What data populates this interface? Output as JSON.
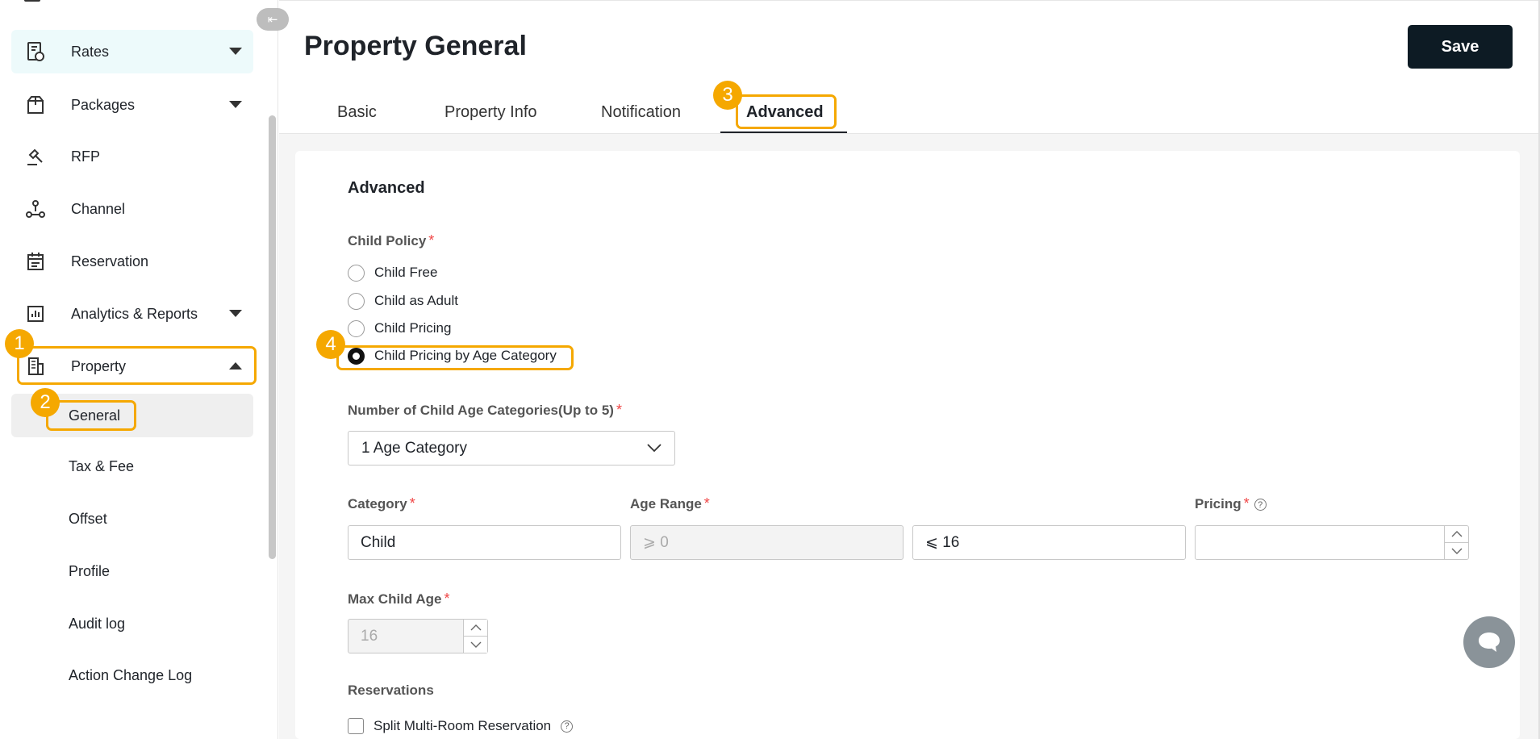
{
  "sidebar": {
    "items": [
      {
        "label": "Rates",
        "icon": "rates-icon"
      },
      {
        "label": "Packages",
        "icon": "packages-icon"
      },
      {
        "label": "RFP",
        "icon": "rfp-icon"
      },
      {
        "label": "Channel",
        "icon": "channel-icon"
      },
      {
        "label": "Reservation",
        "icon": "reservation-icon"
      },
      {
        "label": "Analytics & Reports",
        "icon": "analytics-icon"
      },
      {
        "label": "Property",
        "icon": "building-icon"
      }
    ],
    "property_sub": [
      "General",
      "Tax & Fee",
      "Offset",
      "Profile",
      "Audit log",
      "Action Change Log"
    ]
  },
  "header": {
    "title": "Property General",
    "save_label": "Save"
  },
  "tabs": [
    "Basic",
    "Property Info",
    "Notification",
    "Advanced"
  ],
  "advanced": {
    "section_title": "Advanced",
    "child_policy_label": "Child Policy",
    "child_policy_options": [
      "Child Free",
      "Child as Adult",
      "Child Pricing",
      "Child Pricing by Age Category"
    ],
    "child_policy_selected": "Child Pricing by Age Category",
    "num_categories_label": "Number of Child Age Categories(Up to 5)",
    "num_categories_value": "1 Age Category",
    "category_label": "Category",
    "category_value": "Child",
    "age_range_label": "Age Range",
    "age_min": "⩾ 0",
    "age_max": "⩽ 16",
    "pricing_label": "Pricing",
    "pricing_value": "",
    "max_child_age_label": "Max Child Age",
    "max_child_age_value": "16",
    "reservations_label": "Reservations",
    "split_label": "Split Multi-Room Reservation"
  },
  "badges": [
    "1",
    "2",
    "3",
    "4"
  ],
  "colors": {
    "highlight": "#f5a800",
    "save_bg": "#0d1b24",
    "required": "#f04545",
    "rates_bg": "#edfafb"
  }
}
